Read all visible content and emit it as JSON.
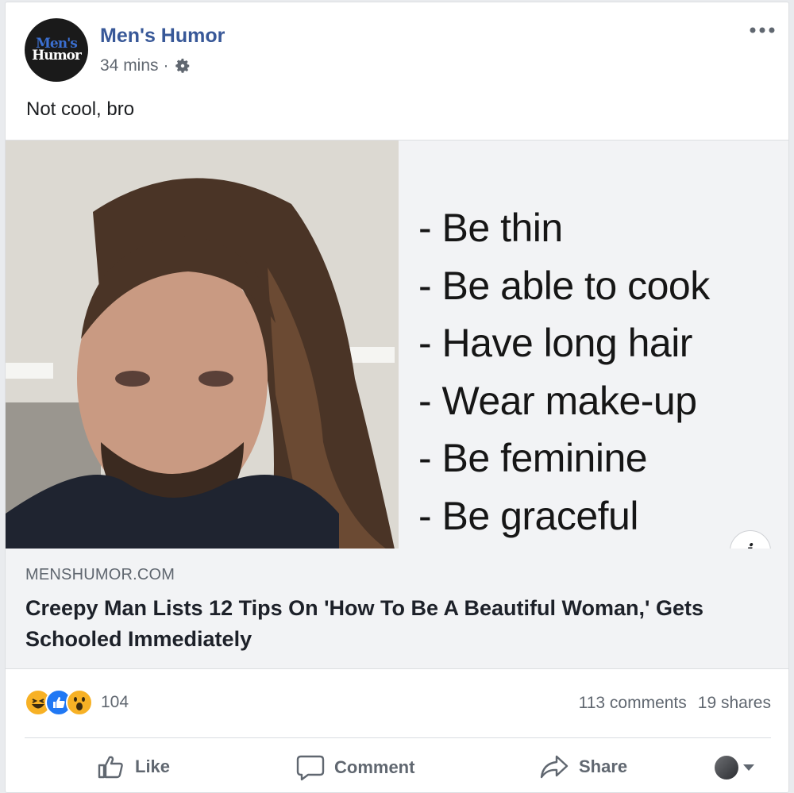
{
  "post": {
    "page_name": "Men's Humor",
    "avatar_text_line1": "Men's",
    "avatar_text_line2": "Humor",
    "time": "34 mins",
    "separator": "·",
    "caption": "Not cool, bro"
  },
  "image": {
    "list_items": [
      "- Be thin",
      "- Be able to cook",
      "- Have long hair",
      "- Wear make-up",
      "- Be feminine",
      "- Be graceful"
    ],
    "info_glyph": "i"
  },
  "link": {
    "domain": "MENSHUMOR.COM",
    "headline": "Creepy Man Lists 12 Tips On 'How To Be A Beautiful Woman,' Gets Schooled Immediately"
  },
  "stats": {
    "reactions": [
      "haha-icon",
      "like-icon",
      "wow-icon"
    ],
    "reaction_count": "104",
    "comments": "113 comments",
    "shares": "19 shares"
  },
  "actions": {
    "like": "Like",
    "comment": "Comment",
    "share": "Share"
  },
  "colors": {
    "brand_blue": "#385898",
    "like_blue": "#2078f4",
    "reaction_yellow": "#f7b125",
    "muted_text": "#606770"
  }
}
